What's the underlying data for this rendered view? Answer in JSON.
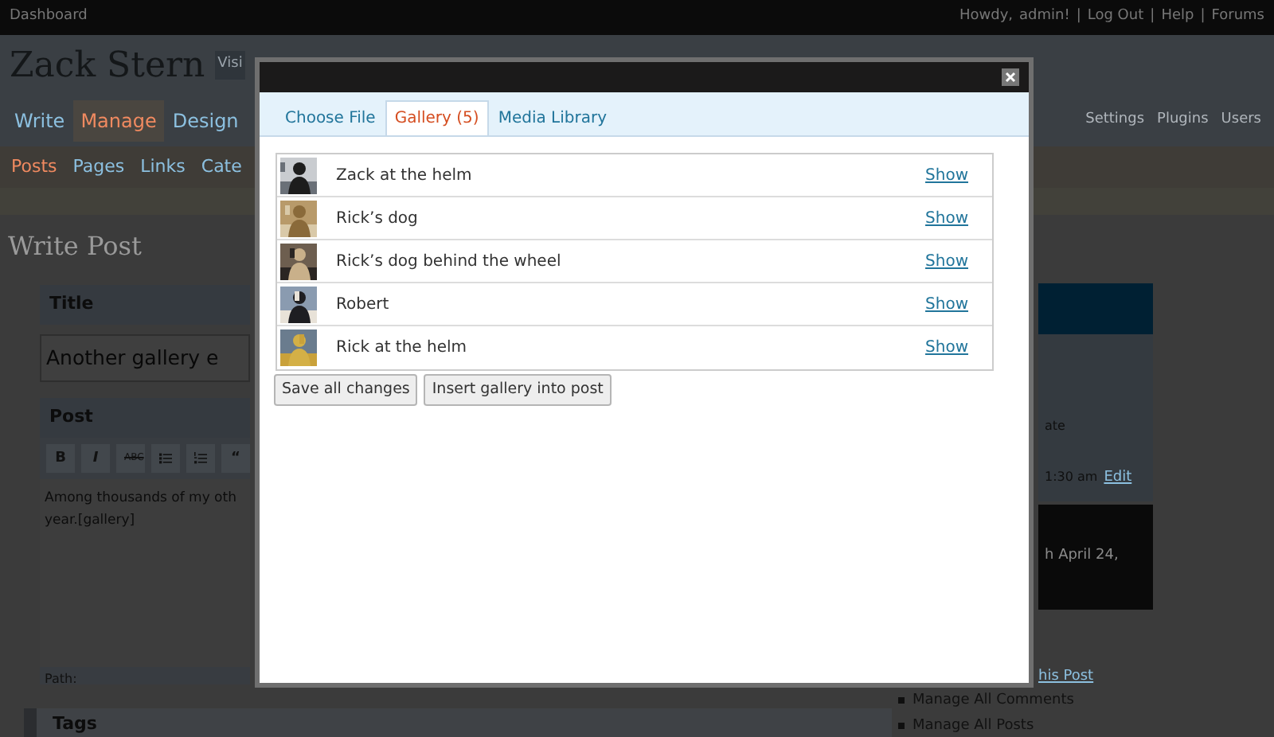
{
  "admin_bar": {
    "dashboard": "Dashboard",
    "greeting": "Howdy,",
    "user": "admin!",
    "links": [
      {
        "separator": "|",
        "label": "Log Out"
      },
      {
        "separator": "|",
        "label": "Help"
      },
      {
        "separator": "|",
        "label": "Forums"
      }
    ]
  },
  "site": {
    "title": "Zack Stern",
    "visit_button": "Visi"
  },
  "menu": [
    {
      "label": "Write",
      "selected": false
    },
    {
      "label": "Manage",
      "selected": true
    },
    {
      "label": "Design",
      "selected": false
    }
  ],
  "settings_menu": [
    "Settings",
    "Plugins",
    "Users"
  ],
  "submenu": [
    {
      "label": "Posts",
      "selected": true
    },
    {
      "label": "Pages",
      "selected": false
    },
    {
      "label": "Links",
      "selected": false
    },
    {
      "label": "Cate",
      "selected": false
    }
  ],
  "page_title": "Write Post",
  "title_box": {
    "heading": "Title",
    "value": "Another gallery e"
  },
  "post_box": {
    "heading": "Post",
    "toolbar": [
      {
        "kind": "bold",
        "label": "B"
      },
      {
        "kind": "italic",
        "label": "I"
      },
      {
        "kind": "strike",
        "label": "ABC"
      },
      {
        "kind": "bullets"
      },
      {
        "kind": "numbers"
      },
      {
        "kind": "quote",
        "label": "“"
      }
    ],
    "lines": [
      "Among thousands of my oth",
      "year.[gallery]"
    ],
    "path_label": "Path:"
  },
  "tags_box": {
    "heading": "Tags"
  },
  "sidebar": {
    "status_fragment": "ate",
    "timestamp": "1:30 am",
    "edit_link": "Edit",
    "notice_fragment": "h April 24,",
    "post_link_fragment": "his Post",
    "links": [
      "Manage All Comments",
      "Manage All Posts"
    ]
  },
  "dialog": {
    "tabs": [
      {
        "label": "Choose File",
        "selected": false
      },
      {
        "label": "Gallery (5)",
        "selected": true
      },
      {
        "label": "Media Library",
        "selected": false
      }
    ],
    "items": [
      {
        "title": "Zack at the helm",
        "action": "Show"
      },
      {
        "title": "Rick’s dog",
        "action": "Show"
      },
      {
        "title": "Rick’s dog behind the wheel",
        "action": "Show"
      },
      {
        "title": "Robert",
        "action": "Show"
      },
      {
        "title": "Rick at the helm",
        "action": "Show"
      }
    ],
    "buttons": [
      "Save all changes",
      "Insert gallery into post"
    ]
  }
}
